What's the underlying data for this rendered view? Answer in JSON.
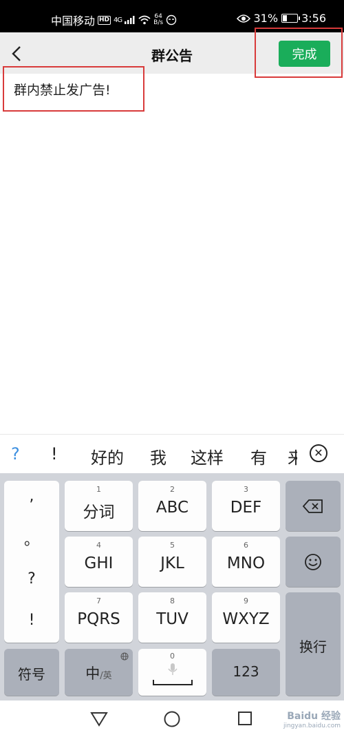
{
  "status_bar": {
    "carrier": "中国移动",
    "hd": "HD",
    "network": "4G",
    "speed_value": "64",
    "speed_unit": "B/s",
    "battery": "31%",
    "time": "3:56"
  },
  "title_bar": {
    "title": "群公告",
    "done_label": "完成"
  },
  "content": {
    "announcement_text": "群内禁止发广告!"
  },
  "candidates": [
    "?",
    "!",
    "好的",
    "我",
    "这样",
    "有",
    "来"
  ],
  "keyboard": {
    "punctuation": [
      ",",
      "。",
      "?",
      "!"
    ],
    "rows": [
      [
        {
          "num": "1",
          "label": "分词"
        },
        {
          "num": "2",
          "label": "ABC"
        },
        {
          "num": "3",
          "label": "DEF"
        }
      ],
      [
        {
          "num": "4",
          "label": "GHI"
        },
        {
          "num": "5",
          "label": "JKL"
        },
        {
          "num": "6",
          "label": "MNO"
        }
      ],
      [
        {
          "num": "7",
          "label": "PQRS"
        },
        {
          "num": "8",
          "label": "TUV"
        },
        {
          "num": "9",
          "label": "WXYZ"
        }
      ]
    ],
    "symbols_label": "符号",
    "lang_main": "中",
    "lang_alt": "/英",
    "space_num": "0",
    "num_label": "123",
    "enter_label": "换行"
  },
  "watermark": {
    "brand": "Baidu 经验",
    "url": "jingyan.baidu.com"
  }
}
